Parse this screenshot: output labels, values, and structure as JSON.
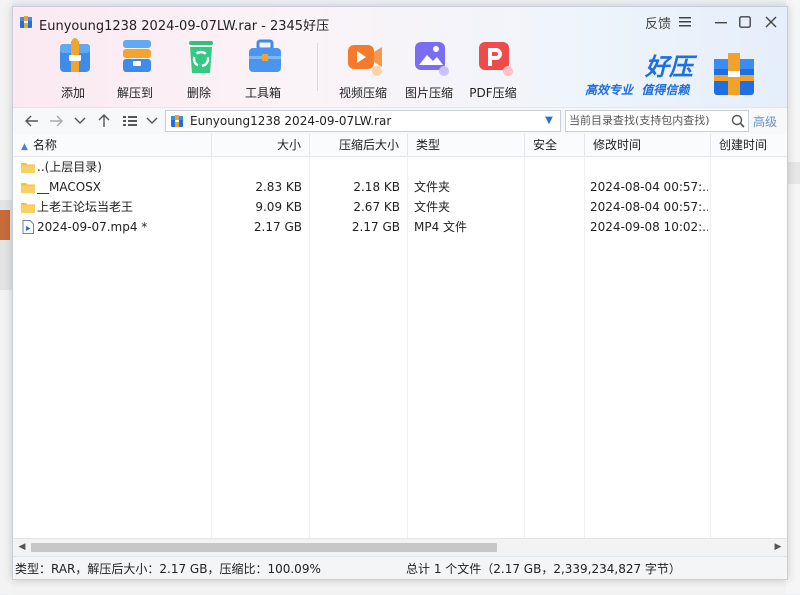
{
  "window": {
    "title": "Eunyoung1238 2024-09-07LW.rar - 2345好压",
    "feedback": "反馈"
  },
  "toolbar": [
    {
      "label": "添加",
      "icon": "add-archive-icon"
    },
    {
      "label": "解压到",
      "icon": "extract-icon"
    },
    {
      "label": "删除",
      "icon": "recycle-delete-icon"
    },
    {
      "label": "工具箱",
      "icon": "toolbox-icon"
    },
    {
      "label": "视频压缩",
      "icon": "video-compress-icon"
    },
    {
      "label": "图片压缩",
      "icon": "image-compress-icon"
    },
    {
      "label": "PDF压缩",
      "icon": "pdf-compress-icon"
    }
  ],
  "brand": {
    "name": "好压",
    "slogan": "高效专业  值得信赖"
  },
  "addressbar": {
    "path": "Eunyoung1238 2024-09-07LW.rar",
    "search_placeholder": "当前目录查找(支持包内查找)",
    "advanced": "高级"
  },
  "columns": [
    "名称",
    "大小",
    "压缩后大小",
    "类型",
    "安全",
    "修改时间",
    "创建时间"
  ],
  "files": [
    {
      "name": "..(上层目录)",
      "size": "",
      "packed": "",
      "type": "",
      "security": "",
      "modified": "",
      "created": "",
      "icon": "folder-icon"
    },
    {
      "name": "__MACOSX",
      "size": "2.83 KB",
      "packed": "2.18 KB",
      "type": "文件夹",
      "security": "",
      "modified": "2024-08-04 00:57:...",
      "created": "",
      "icon": "folder-icon"
    },
    {
      "name": "上老王论坛当老王",
      "size": "9.09 KB",
      "packed": "2.67 KB",
      "type": "文件夹",
      "security": "",
      "modified": "2024-08-04 00:57:...",
      "created": "",
      "icon": "folder-icon"
    },
    {
      "name": "2024-09-07.mp4 *",
      "size": "2.17 GB",
      "packed": "2.17 GB",
      "type": "MP4 文件",
      "security": "",
      "modified": "2024-09-08 10:02:...",
      "created": "",
      "icon": "video-file-icon"
    }
  ],
  "status": {
    "left": "类型：RAR，解压后大小：2.17 GB，压缩比：100.09%",
    "right": "总计 1 个文件（2.17 GB，2,339,234,827 字节）"
  },
  "colors": {
    "accent": "#2a6fd6",
    "folder": "#f5c242",
    "brand_blue": "#1f6fe0"
  }
}
